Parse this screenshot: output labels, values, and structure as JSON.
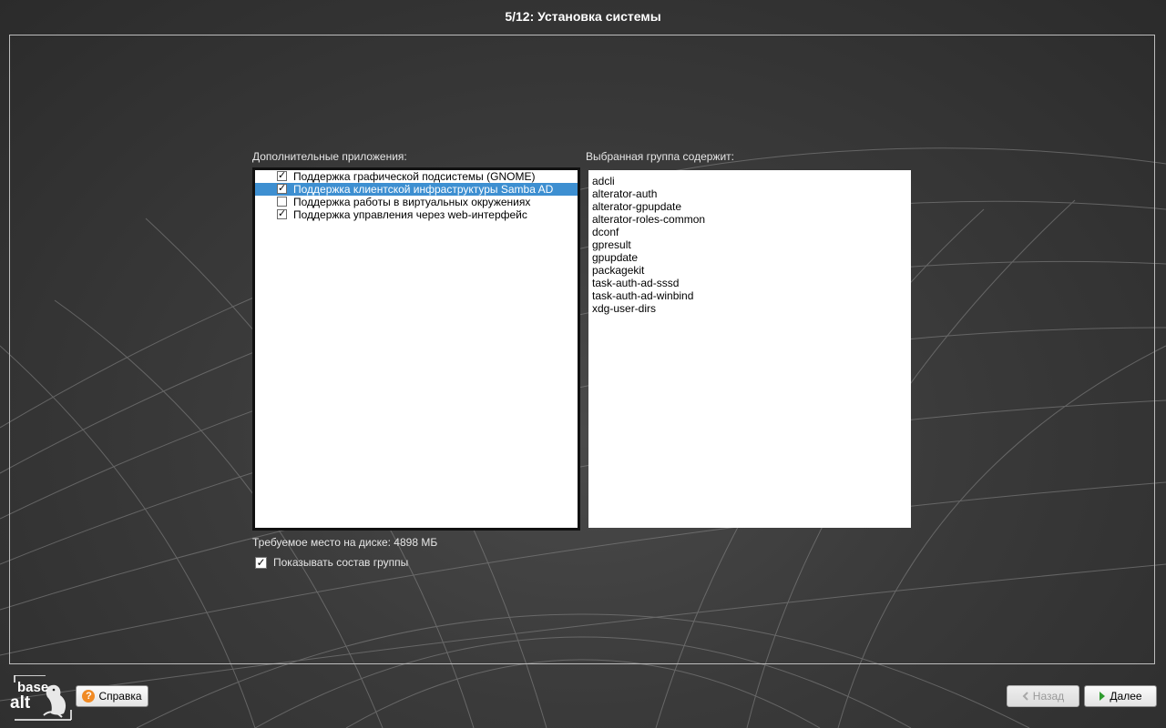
{
  "window": {
    "title": "5/12: Установка системы"
  },
  "left_panel": {
    "label": "Дополнительные приложения:",
    "items": [
      {
        "label": "Поддержка графической подсистемы (GNOME)",
        "checked": true,
        "selected": false
      },
      {
        "label": "Поддержка клиентской инфраструктуры Samba AD",
        "checked": true,
        "selected": true
      },
      {
        "label": "Поддержка работы в виртуальных окружениях",
        "checked": false,
        "selected": false
      },
      {
        "label": "Поддержка управления через web-интерфейс",
        "checked": true,
        "selected": false
      }
    ]
  },
  "right_panel": {
    "label": "Выбранная группа содержит:",
    "packages": [
      "adcli",
      "alterator-auth",
      "alterator-gpupdate",
      "alterator-roles-common",
      "dconf",
      "gpresult",
      "gpupdate",
      "packagekit",
      "task-auth-ad-sssd",
      "task-auth-ad-winbind",
      "xdg-user-dirs"
    ]
  },
  "disk": {
    "label": "Требуемое место на диске: 4898 МБ"
  },
  "show_group": {
    "label": "Показывать состав группы",
    "checked": true
  },
  "logo": {
    "line1": "base",
    "line2": "alt"
  },
  "footer": {
    "help_label": "Справка",
    "back_label": "Назад",
    "next_label": "Далее"
  },
  "colors": {
    "selection": "#3d8fd1",
    "help_icon": "#f08a24",
    "next_arrow": "#2e9b2e"
  }
}
